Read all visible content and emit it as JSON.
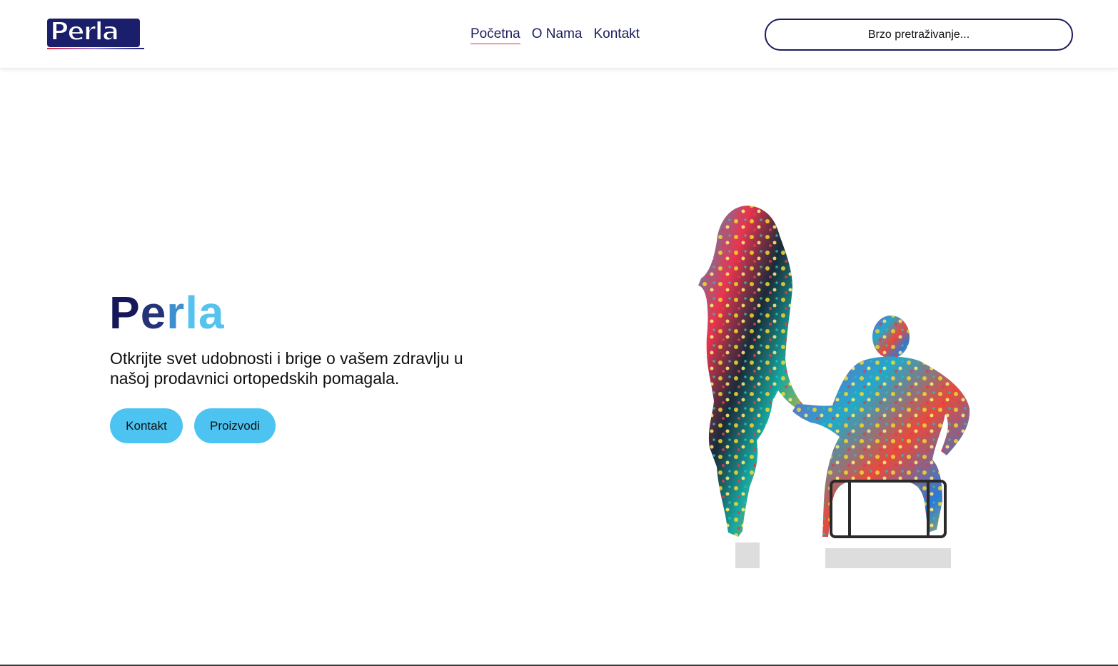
{
  "header": {
    "logo_text": "Perla",
    "nav": [
      {
        "label": "Početna",
        "active": true
      },
      {
        "label": "O Nama",
        "active": false
      },
      {
        "label": "Kontakt",
        "active": false
      }
    ],
    "search_placeholder": "Brzo pretraživanje..."
  },
  "hero": {
    "title_parts": [
      "P",
      "e",
      "r",
      "la"
    ],
    "tagline": "Otkrijte svet udobnosti i brige o vašem zdravlju u našoj prodavnici ortopedskih pomagala.",
    "buttons": [
      "Kontakt",
      "Proizvodi"
    ]
  },
  "colors": {
    "navy": "#1a1c5e",
    "accent_red": "#e3243b",
    "button_blue": "#4cc3f1",
    "title_light": "#56c2ee"
  },
  "icons": [
    "perla-logo",
    "people-silhouette-illustration"
  ]
}
